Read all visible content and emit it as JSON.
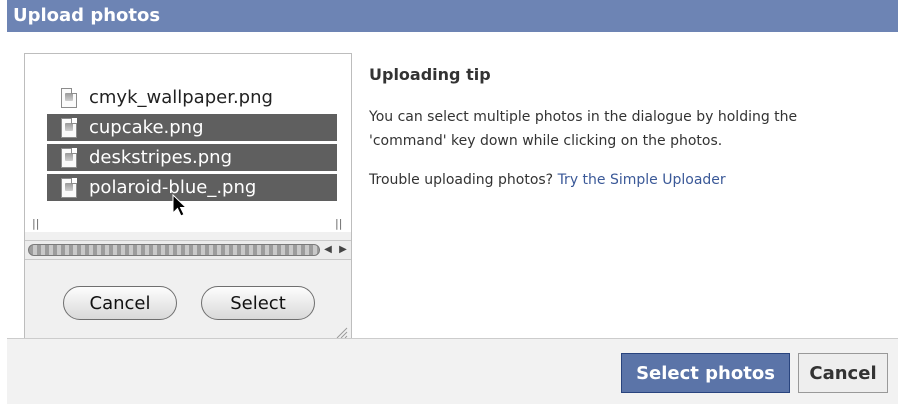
{
  "dialog": {
    "title": "Upload photos"
  },
  "chooser": {
    "files": [
      {
        "name": "cmyk_wallpaper.png",
        "selected": false
      },
      {
        "name": "cupcake.png",
        "selected": true
      },
      {
        "name": "deskstripes.png",
        "selected": true
      },
      {
        "name": "polaroid-blue_.png",
        "selected": true
      }
    ],
    "column_separator": "||",
    "cancel_label": "Cancel",
    "select_label": "Select",
    "icons": {
      "file": "document-icon",
      "scroll_left": "arrow-left-icon",
      "scroll_right": "arrow-right-icon",
      "cursor": "mouse-pointer-icon",
      "grip": "resize-grip-icon"
    }
  },
  "tip": {
    "title": "Uploading tip",
    "body": "You can select multiple photos in the dialogue by holding the 'command' key down while clicking on the photos.",
    "trouble_text": "Trouble uploading photos? ",
    "trouble_link": "Try the Simple Uploader"
  },
  "footer": {
    "select_photos_label": "Select photos",
    "cancel_label": "Cancel"
  },
  "colors": {
    "header": "#6d84b4",
    "primary_button": "#5b74a8",
    "link": "#3b5998",
    "selection": "#5f5f5f"
  }
}
